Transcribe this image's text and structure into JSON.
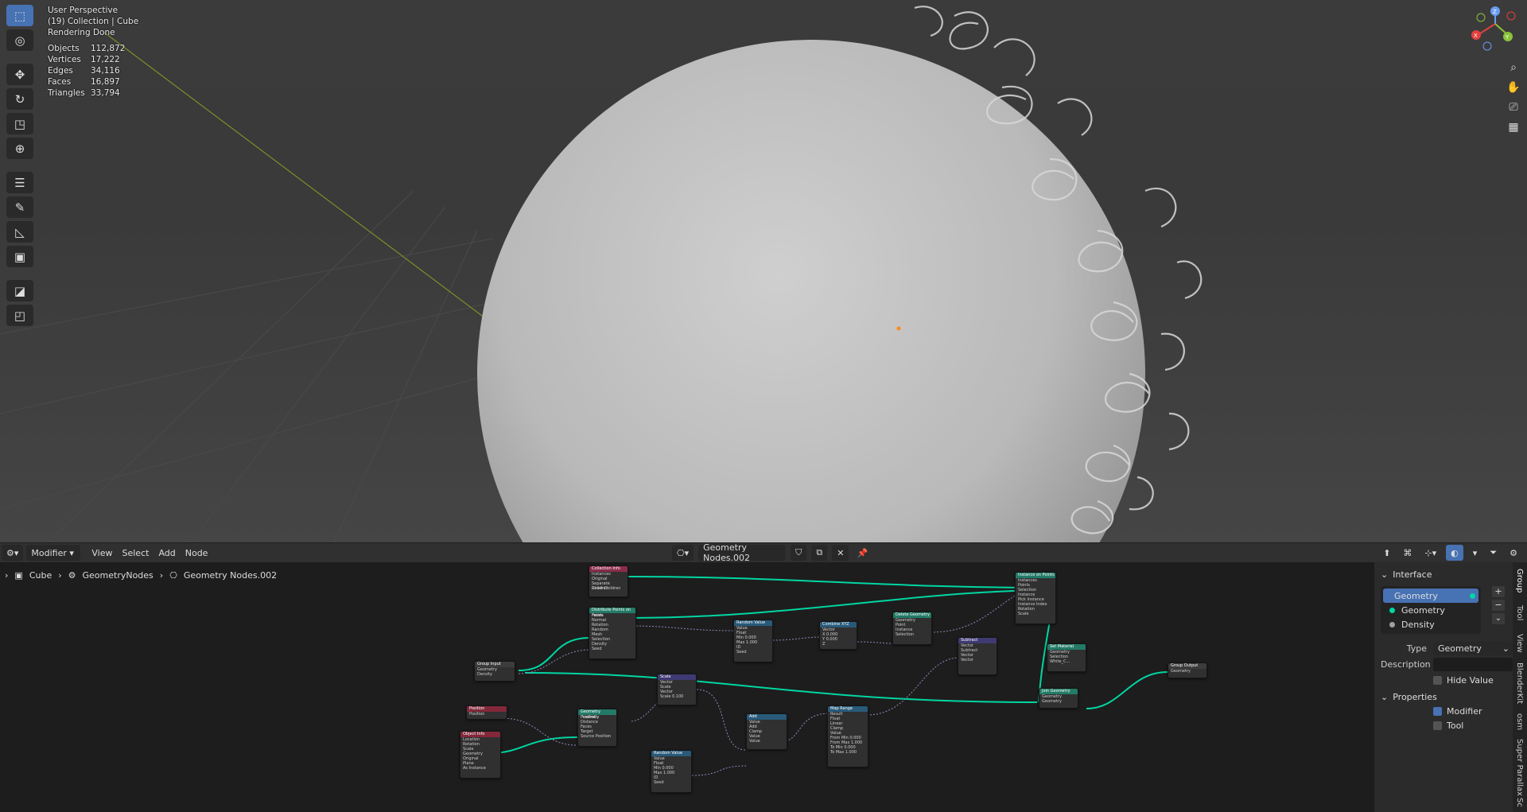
{
  "viewport": {
    "perspective": "User Perspective",
    "collection": "(19) Collection | Cube",
    "status": "Rendering Done",
    "stats": [
      {
        "label": "Objects",
        "value": "112,872"
      },
      {
        "label": "Vertices",
        "value": "17,222"
      },
      {
        "label": "Edges",
        "value": "34,116"
      },
      {
        "label": "Faces",
        "value": "16,897"
      },
      {
        "label": "Triangles",
        "value": "33,794"
      }
    ],
    "gizmo": {
      "x": "X",
      "y": "Y",
      "z": "Z"
    }
  },
  "header": {
    "editor_mode": "Modifier",
    "menus": [
      "View",
      "Select",
      "Add",
      "Node"
    ],
    "node_group": "Geometry Nodes.002"
  },
  "breadcrumb": [
    "Cube",
    "GeometryNodes",
    "Geometry Nodes.002"
  ],
  "nodes": {
    "collection_info": {
      "title": "Collection Info",
      "rows": [
        "Instances",
        "Original",
        "Relative",
        "Separate Children",
        "Reset Children"
      ]
    },
    "distribute": {
      "title": "Distribute Points on Faces",
      "rows": [
        "Points",
        "Normal",
        "Rotation",
        "Random",
        "Mesh",
        "Selection",
        "Density",
        "Seed"
      ]
    },
    "random_value_1": {
      "title": "Random Value",
      "rows": [
        "Value",
        "Float",
        "Min 0.000",
        "Max 1.000",
        "ID",
        "Seed"
      ]
    },
    "combine_xyz": {
      "title": "Combine XYZ",
      "rows": [
        "Vector",
        "X 0.000",
        "Y 0.000",
        "Z"
      ]
    },
    "delete_geometry": {
      "title": "Delete Geometry",
      "rows": [
        "Geometry",
        "Point",
        "Instance",
        "Selection"
      ]
    },
    "instance_on_points": {
      "title": "Instance on Points",
      "rows": [
        "Instances",
        "Points",
        "Selection",
        "Instance",
        "Pick Instance",
        "Instance Index",
        "Rotation",
        "Scale"
      ]
    },
    "subtract": {
      "title": "Subtract",
      "rows": [
        "Vector",
        "Subtract",
        "Vector",
        "Vector"
      ]
    },
    "group_input": {
      "title": "Group Input",
      "rows": [
        "Geometry",
        "Density"
      ]
    },
    "scale": {
      "title": "Scale",
      "rows": [
        "Vector",
        "Scale",
        "Vector",
        "Scale 0.100"
      ]
    },
    "set_material": {
      "title": "Set Material",
      "rows": [
        "Geometry",
        "Geometry",
        "Selection",
        "White_C..."
      ]
    },
    "join_geometry": {
      "title": "Join Geometry",
      "rows": [
        "Geometry",
        "Geometry"
      ]
    },
    "group_output": {
      "title": "Group Output",
      "rows": [
        "Geometry"
      ]
    },
    "position": {
      "title": "Position",
      "rows": [
        "Position"
      ]
    },
    "geometry_proximity": {
      "title": "Geometry Proximity",
      "rows": [
        "Position",
        "Distance",
        "Faces",
        "Target",
        "Source Position"
      ]
    },
    "object_info": {
      "title": "Object Info",
      "rows": [
        "Location",
        "Rotation",
        "Scale",
        "Geometry",
        "Original",
        "Relative",
        "Plane",
        "As Instance"
      ]
    },
    "add": {
      "title": "Add",
      "rows": [
        "Value",
        "Add",
        "Clamp",
        "Value",
        "Value"
      ]
    },
    "map_range": {
      "title": "Map Range",
      "rows": [
        "Result",
        "Float",
        "Linear",
        "Clamp",
        "Value",
        "From Min 0.000",
        "From Max 1.000",
        "To Min 0.000",
        "To Max 1.000"
      ]
    },
    "random_value_2": {
      "title": "Random Value",
      "rows": [
        "Value",
        "Float",
        "Min 0.000",
        "Max 1.000",
        "ID",
        "Seed"
      ]
    }
  },
  "sidebar": {
    "interface_label": "Interface",
    "interface_items": [
      {
        "label": "Geometry",
        "selected": true,
        "dot": "teal"
      },
      {
        "label": "Geometry",
        "selected": false,
        "dot": "teal"
      },
      {
        "label": "Density",
        "selected": false,
        "dot": "gray"
      }
    ],
    "type_label": "Type",
    "type_value": "Geometry",
    "description_label": "Description",
    "hide_value_label": "Hide Value",
    "properties_label": "Properties",
    "modifier_label": "Modifier",
    "modifier_checked": true,
    "tool_label": "Tool",
    "tool_checked": false,
    "tabs": [
      "Group",
      "Tool",
      "View",
      "BlenderKit",
      "osm",
      "Super Parallax",
      "Sc"
    ]
  },
  "colors": {
    "accent": "#4772b3",
    "socket_geometry": "#00d6a3"
  }
}
